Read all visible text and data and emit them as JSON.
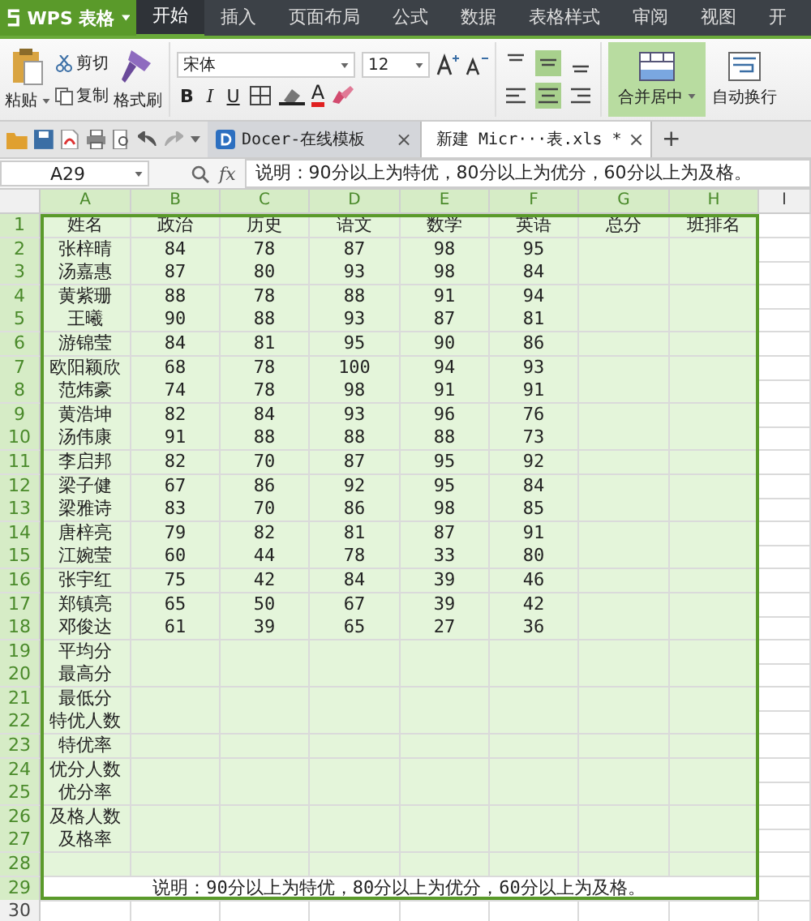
{
  "app": {
    "title": "WPS 表格"
  },
  "menu_tabs": [
    {
      "label": "开始",
      "selected": true
    },
    {
      "label": "插入",
      "selected": false
    },
    {
      "label": "页面布局",
      "selected": false
    },
    {
      "label": "公式",
      "selected": false
    },
    {
      "label": "数据",
      "selected": false
    },
    {
      "label": "表格样式",
      "selected": false
    },
    {
      "label": "审阅",
      "selected": false
    },
    {
      "label": "视图",
      "selected": false
    },
    {
      "label": "开",
      "selected": false
    }
  ],
  "ribbon": {
    "paste": "粘贴",
    "cut": "剪切",
    "copy": "复制",
    "format_painter": "格式刷",
    "font": "宋体",
    "font_size": "12",
    "styles": [
      "B",
      "I",
      "U"
    ],
    "font_color_letter": "A",
    "merge": "合并居中",
    "wrap": "自动换行"
  },
  "doc_tabs": [
    {
      "label": "Docer-在线模板",
      "close": "×",
      "selected": false
    },
    {
      "label": "新建 Micr···表.xls *",
      "close": "×",
      "selected": true
    }
  ],
  "new_tab": "+",
  "formula_bar": {
    "name_box": "A29",
    "fx": "fx",
    "content": "说明：90分以上为特优，80分以上为优分，60分以上为及格。"
  },
  "columns": [
    {
      "label": "A",
      "selected": true
    },
    {
      "label": "B",
      "selected": true
    },
    {
      "label": "C",
      "selected": true
    },
    {
      "label": "D",
      "selected": true
    },
    {
      "label": "E",
      "selected": true
    },
    {
      "label": "F",
      "selected": true
    },
    {
      "label": "G",
      "selected": true
    },
    {
      "label": "H",
      "selected": true
    },
    {
      "label": "I",
      "selected": false
    }
  ],
  "rows": [
    {
      "num": "1",
      "selected": true,
      "cells": [
        "姓名",
        "政治",
        "历史",
        "语文",
        "数学",
        "英语",
        "总分",
        "班排名"
      ]
    },
    {
      "num": "2",
      "selected": true,
      "cells": [
        "张梓晴",
        "84",
        "78",
        "87",
        "98",
        "95"
      ]
    },
    {
      "num": "3",
      "selected": true,
      "cells": [
        "汤嘉惠",
        "87",
        "80",
        "93",
        "98",
        "84"
      ]
    },
    {
      "num": "4",
      "selected": true,
      "cells": [
        "黄紫珊",
        "88",
        "78",
        "88",
        "91",
        "94"
      ]
    },
    {
      "num": "5",
      "selected": true,
      "cells": [
        "王曦",
        "90",
        "88",
        "93",
        "87",
        "81"
      ]
    },
    {
      "num": "6",
      "selected": true,
      "cells": [
        "游锦莹",
        "84",
        "81",
        "95",
        "90",
        "86"
      ]
    },
    {
      "num": "7",
      "selected": true,
      "cells": [
        "欧阳颖欣",
        "68",
        "78",
        "100",
        "94",
        "93"
      ]
    },
    {
      "num": "8",
      "selected": true,
      "cells": [
        "范炜豪",
        "74",
        "78",
        "98",
        "91",
        "91"
      ]
    },
    {
      "num": "9",
      "selected": true,
      "cells": [
        "黄浩坤",
        "82",
        "84",
        "93",
        "96",
        "76"
      ]
    },
    {
      "num": "10",
      "selected": true,
      "cells": [
        "汤伟康",
        "91",
        "88",
        "88",
        "88",
        "73"
      ]
    },
    {
      "num": "11",
      "selected": true,
      "cells": [
        "李启邦",
        "82",
        "70",
        "87",
        "95",
        "92"
      ]
    },
    {
      "num": "12",
      "selected": true,
      "cells": [
        "梁子健",
        "67",
        "86",
        "92",
        "95",
        "84"
      ]
    },
    {
      "num": "13",
      "selected": true,
      "cells": [
        "梁雅诗",
        "83",
        "70",
        "86",
        "98",
        "85"
      ]
    },
    {
      "num": "14",
      "selected": true,
      "cells": [
        "唐梓亮",
        "79",
        "82",
        "81",
        "87",
        "91"
      ]
    },
    {
      "num": "15",
      "selected": true,
      "cells": [
        "江婉莹",
        "60",
        "44",
        "78",
        "33",
        "80"
      ]
    },
    {
      "num": "16",
      "selected": true,
      "cells": [
        "张宇红",
        "75",
        "42",
        "84",
        "39",
        "46"
      ]
    },
    {
      "num": "17",
      "selected": true,
      "cells": [
        "郑镇亮",
        "65",
        "50",
        "67",
        "39",
        "42"
      ]
    },
    {
      "num": "18",
      "selected": true,
      "cells": [
        "邓俊达",
        "61",
        "39",
        "65",
        "27",
        "36"
      ]
    },
    {
      "num": "19",
      "selected": true,
      "cells": [
        "平均分"
      ]
    },
    {
      "num": "20",
      "selected": true,
      "cells": [
        "最高分"
      ]
    },
    {
      "num": "21",
      "selected": true,
      "cells": [
        "最低分"
      ]
    },
    {
      "num": "22",
      "selected": true,
      "cells": [
        "特优人数"
      ]
    },
    {
      "num": "23",
      "selected": true,
      "cells": [
        "特优率"
      ]
    },
    {
      "num": "24",
      "selected": true,
      "cells": [
        "优分人数"
      ]
    },
    {
      "num": "25",
      "selected": true,
      "cells": [
        "优分率"
      ]
    },
    {
      "num": "26",
      "selected": true,
      "cells": [
        "及格人数"
      ]
    },
    {
      "num": "27",
      "selected": true,
      "cells": [
        "及格率"
      ]
    },
    {
      "num": "28",
      "selected": true
    },
    {
      "num": "29",
      "selected": true,
      "active": true,
      "merged": "说明：90分以上为特优，80分以上为优分，60分以上为及格。"
    },
    {
      "num": "30",
      "selected": false
    }
  ]
}
